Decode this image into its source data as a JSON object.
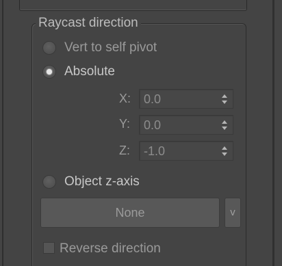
{
  "group": {
    "title": "Raycast direction"
  },
  "options": {
    "vert_to_self_pivot": {
      "label": "Vert to self pivot",
      "checked": false,
      "enabled": false
    },
    "absolute": {
      "label": "Absolute",
      "checked": true,
      "enabled": true
    },
    "object_z_axis": {
      "label": "Object z-axis",
      "checked": false,
      "enabled": true
    }
  },
  "axes": {
    "x": {
      "label": "X:",
      "value": "0.0"
    },
    "y": {
      "label": "Y:",
      "value": "0.0"
    },
    "z": {
      "label": "Z:",
      "value": "-1.0"
    }
  },
  "object_picker": {
    "label": "None",
    "dropdown_label": "v"
  },
  "reverse": {
    "label": "Reverse direction",
    "checked": false
  },
  "colors": {
    "panel_bg": "#444444",
    "text": "#c8c8c8",
    "text_disabled": "#9a9a9a",
    "button_bg": "#585858"
  }
}
